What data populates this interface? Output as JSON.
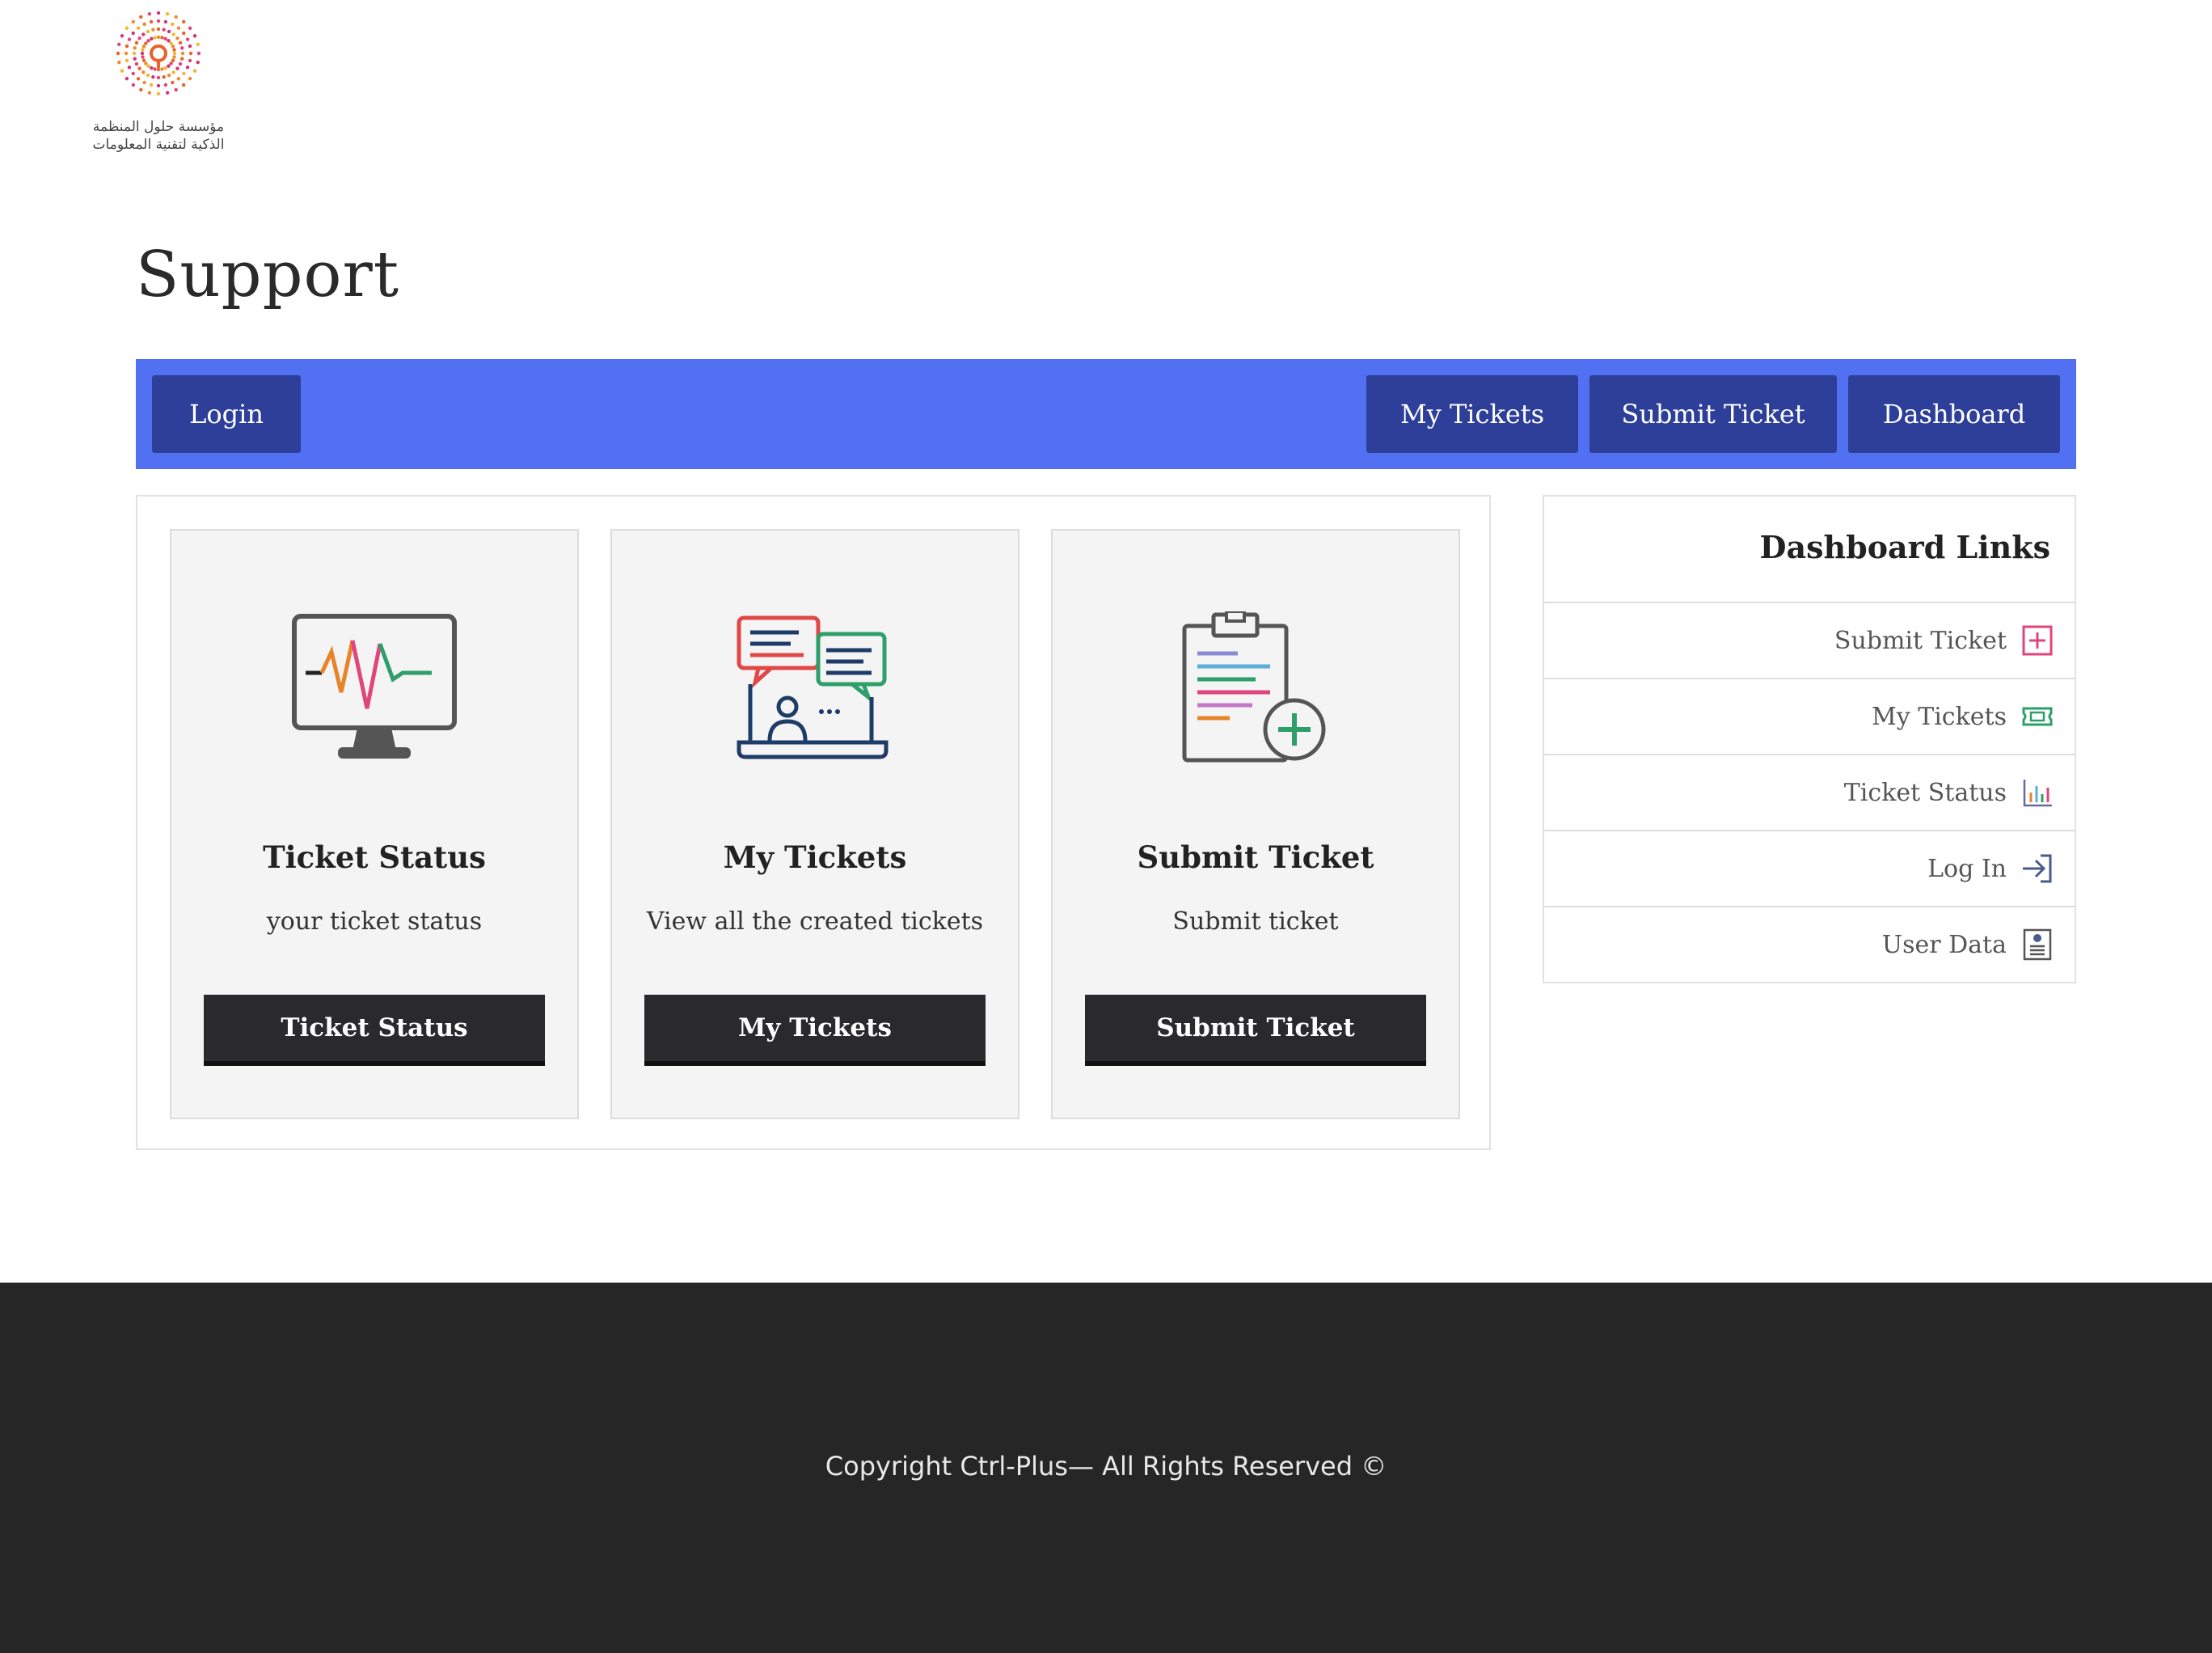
{
  "logo": {
    "line1": "مؤسسة حلول المنظمة",
    "line2": "الذكية لتقنية المعلومات"
  },
  "page_title": "Support",
  "nav": {
    "login": "Login",
    "my_tickets": "My Tickets",
    "submit_ticket": "Submit Ticket",
    "dashboard": "Dashboard"
  },
  "cards": [
    {
      "icon": "monitor-pulse-icon",
      "title": "Ticket Status",
      "desc": "your ticket status",
      "button": "Ticket Status"
    },
    {
      "icon": "chat-laptop-icon",
      "title": "My Tickets",
      "desc": "View all the created tickets",
      "button": "My Tickets"
    },
    {
      "icon": "clipboard-add-icon",
      "title": "Submit Ticket",
      "desc": "Submit ticket",
      "button": "Submit Ticket"
    }
  ],
  "dashboard_links": {
    "title": "Dashboard Links",
    "items": [
      {
        "label": "Submit Ticket",
        "icon": "plus-square-icon",
        "color": "#e0457b"
      },
      {
        "label": "My Tickets",
        "icon": "ticket-icon",
        "color": "#2e9e6a"
      },
      {
        "label": "Ticket Status",
        "icon": "bar-chart-icon",
        "color": "#6a6a9a"
      },
      {
        "label": "Log In",
        "icon": "login-arrow-icon",
        "color": "#4a5a8a"
      },
      {
        "label": "User Data",
        "icon": "user-card-icon",
        "color": "#555555"
      }
    ]
  },
  "footer": {
    "copyright": "Copyright Ctrl-Plus— All Rights Reserved ©"
  },
  "colors": {
    "navbar": "#5270f2",
    "nav_button": "#2e3f9a",
    "card_button": "#2a2a2c",
    "footer": "#262626"
  }
}
